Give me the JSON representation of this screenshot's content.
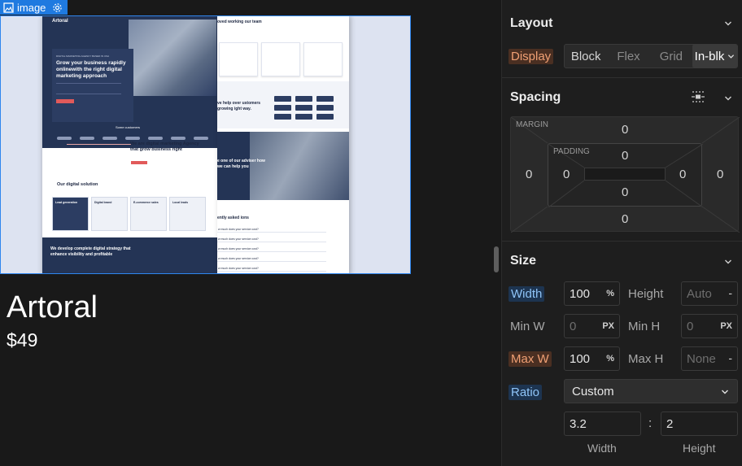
{
  "canvas": {
    "selection_tag": "image",
    "product_name": "Artoral",
    "product_price": "$49",
    "preview": {
      "logo": "Artoral",
      "hero_small": "DIGITAL MARKETING AGENCY BASED IN USA",
      "hero_title": "Grow your business  rapidly onlinewith the right digital marketing approach",
      "some_customers": "Some customers",
      "agency_title": "We are digital marketing Agency that grow business right",
      "solution_title": "Our digital solution",
      "solution_cards": [
        "Lead generation",
        "Digital brand",
        "E-commerce sales",
        "Local leads"
      ],
      "bottom_title": "We develop complete digital strategy that enhance visibility and profitable",
      "right_title_1": "oved working our team",
      "right_title_2": "ve help over ustomers growing ight way.",
      "right_title_3": "e one of our adviser how we can help you",
      "faq_title": "ently asked ions",
      "faq_items": [
        "w much does your service cost?",
        "w much does your service cost?",
        "w much does your service cost?",
        "w much does your service cost?",
        "w much does your service cost?"
      ]
    }
  },
  "panel": {
    "layout": {
      "title": "Layout",
      "display_label": "Display",
      "options": [
        "Block",
        "Flex",
        "Grid",
        "In-blk"
      ],
      "active": "In-blk"
    },
    "spacing": {
      "title": "Spacing",
      "margin_label": "MARGIN",
      "padding_label": "PADDING",
      "margin": {
        "top": "0",
        "right": "0",
        "bottom": "0",
        "left": "0"
      },
      "padding": {
        "top": "0",
        "right": "0",
        "bottom": "0",
        "left": "0"
      }
    },
    "size": {
      "title": "Size",
      "width_label": "Width",
      "width_value": "100",
      "width_unit": "%",
      "height_label": "Height",
      "height_value": "Auto",
      "height_unit": "-",
      "min_w_label": "Min W",
      "min_w_value": "0",
      "min_w_unit": "PX",
      "min_h_label": "Min H",
      "min_h_value": "0",
      "min_h_unit": "PX",
      "max_w_label": "Max W",
      "max_w_value": "100",
      "max_w_unit": "%",
      "max_h_label": "Max H",
      "max_h_value": "None",
      "max_h_unit": "-",
      "ratio_label": "Ratio",
      "ratio_value": "Custom",
      "ratio_width": "3.2",
      "ratio_sep": ":",
      "ratio_height": "2",
      "ratio_width_label": "Width",
      "ratio_height_label": "Height"
    }
  },
  "colors": {
    "selection": "#1f7ae0",
    "panel_bg": "#1e1e1e",
    "highlight_orange": "#f0a074",
    "highlight_blue": "#8fc4f7"
  },
  "icons": [
    "image-icon",
    "gear-icon",
    "chevron-down-icon",
    "spacing-mode-icon"
  ]
}
